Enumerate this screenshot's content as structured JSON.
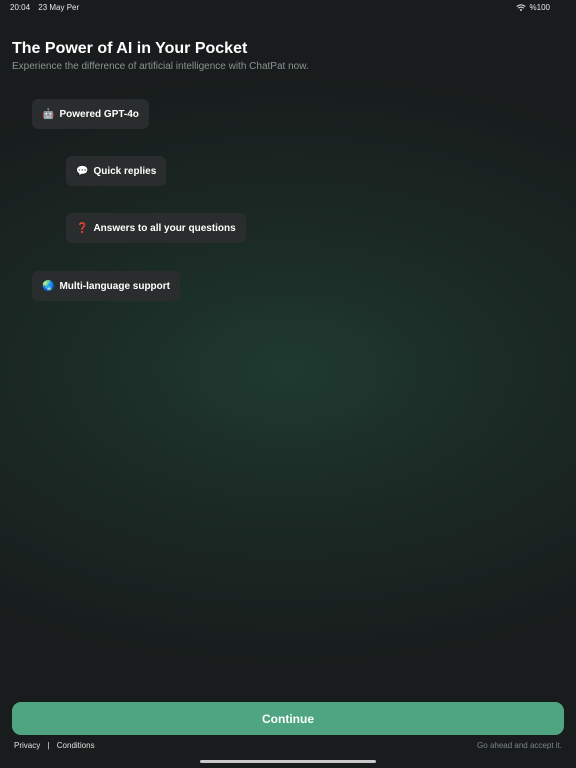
{
  "status_bar": {
    "time": "20:04",
    "date": "23 May Per",
    "battery": "%100",
    "wifi_icon": "wifi-icon"
  },
  "header": {
    "title": "The Power of AI in Your Pocket",
    "subtitle": "Experience the difference of artificial intelligence with ChatPat now."
  },
  "features": [
    {
      "emoji": "🤖",
      "label": "Powered GPT-4o",
      "icon": "robot-icon"
    },
    {
      "emoji": "💬",
      "label": "Quick replies",
      "icon": "speech-bubble-icon"
    },
    {
      "emoji": "❓",
      "label": "Answers to all your questions",
      "icon": "question-mark-icon"
    },
    {
      "emoji": "🌏",
      "label": "Multi-language support",
      "icon": "globe-icon"
    }
  ],
  "cta": {
    "continue_label": "Continue"
  },
  "footer": {
    "privacy_label": "Privacy",
    "separator": "|",
    "conditions_label": "Conditions",
    "note": "Go ahead and accept it."
  },
  "colors": {
    "accent": "#4fa582",
    "chip_bg": "#2a2d2d",
    "bg_dark": "#181c1c",
    "bg_glow": "#1f3a30"
  }
}
